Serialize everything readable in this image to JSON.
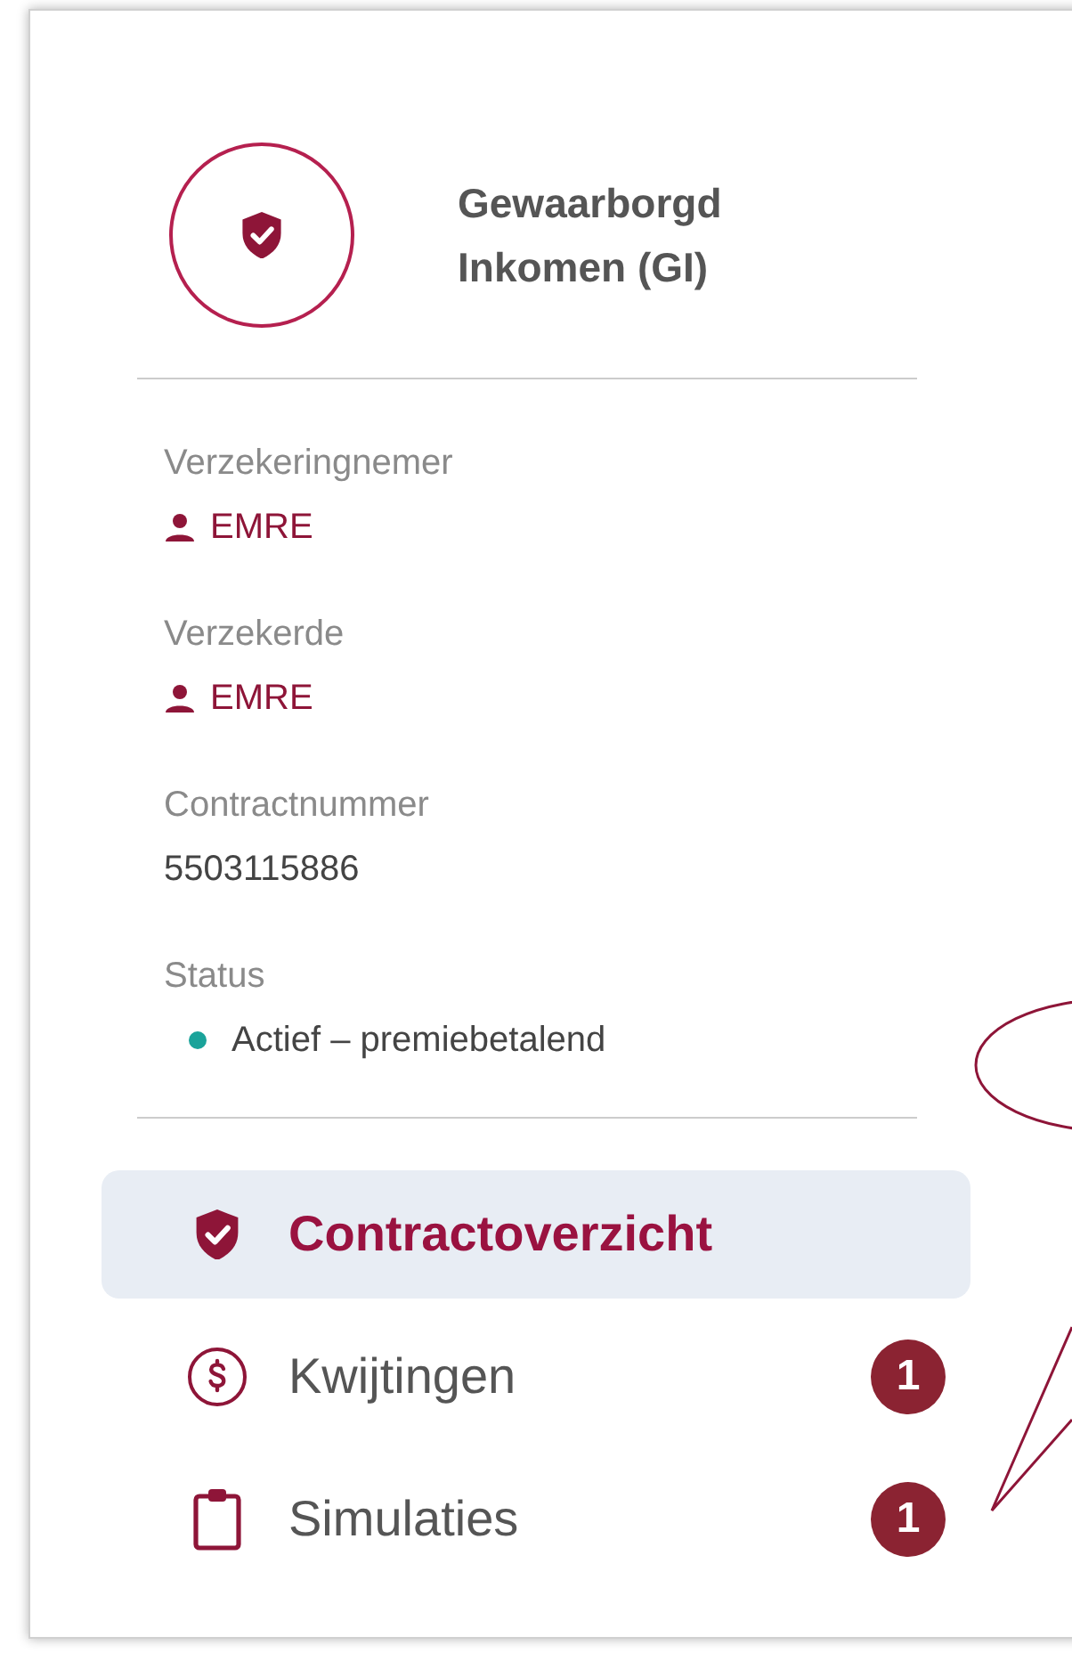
{
  "product": {
    "title": "Gewaarborgd Inkomen (GI)"
  },
  "fields": [
    {
      "kind": "person",
      "label": "Verzekeringnemer",
      "value": "EMRE"
    },
    {
      "kind": "person",
      "label": "Verzekerde",
      "value": "EMRE"
    },
    {
      "kind": "text",
      "label": "Contractnummer",
      "value": "5503115886"
    },
    {
      "kind": "status",
      "label": "Status",
      "value": "Actief – premiebetalend",
      "color": "#1aa39a"
    }
  ],
  "nav": [
    {
      "kind": "shield",
      "label": "Contractoverzicht",
      "selected": true
    },
    {
      "kind": "dollar",
      "label": "Kwijtingen",
      "selected": false,
      "badge": "1"
    },
    {
      "kind": "clipboard",
      "label": "Simulaties",
      "selected": false,
      "badge": "1"
    }
  ]
}
